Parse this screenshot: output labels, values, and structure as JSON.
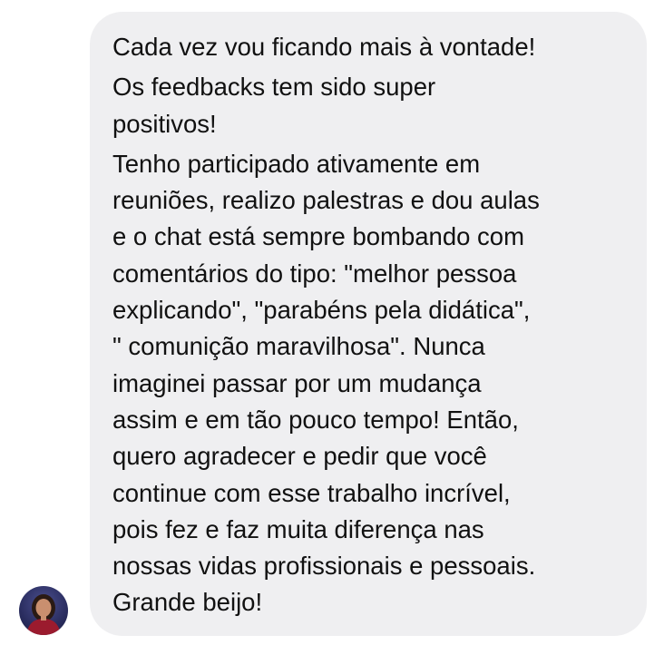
{
  "conversation": {
    "messages": [
      {
        "text": "Cada vez vou ficando mais à vontade!"
      },
      {
        "text": "Os feedbacks tem sido super\npositivos!"
      },
      {
        "text": "Tenho participado ativamente em\nreuniões, realizo palestras e dou aulas\ne o chat está sempre bombando com\ncomentários do tipo: \"melhor pessoa\nexplicando\",  \"parabéns pela didática\",\n\" comunição maravilhosa\". Nunca\nimaginei passar por um mudança\nassim e em tão pouco tempo! Então,\nquero agradecer e pedir que você\ncontinue com esse trabalho incrível,\npois fez e faz muita diferença nas\nnossas vidas profissionais e pessoais.\nGrande beijo!"
      }
    ],
    "bubble_color": "#efeff1",
    "text_color": "#111111"
  },
  "sender": {
    "avatar_icon": "profile-photo-avatar"
  }
}
